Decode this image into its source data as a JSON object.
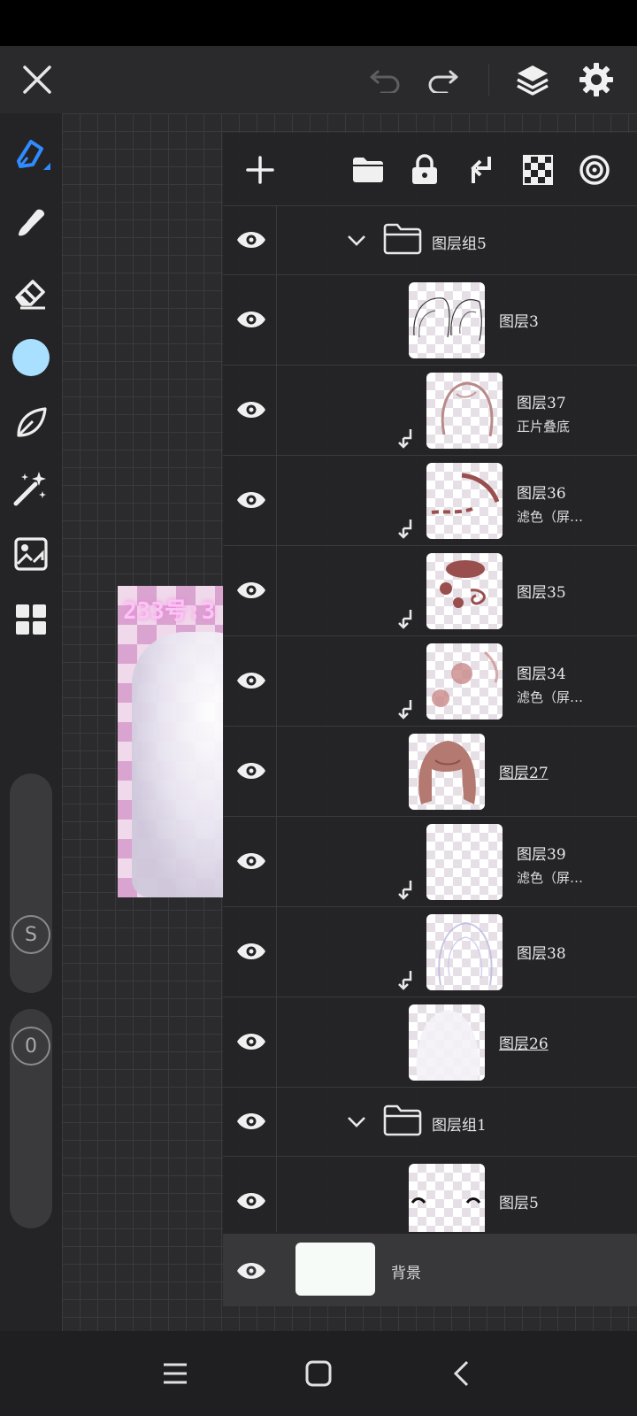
{
  "colors": {
    "accent_blue": "#2f8bff",
    "brush_color": "#a9e0ff",
    "panel_bg": "#242426",
    "text": "#e8e8e8"
  },
  "topbar": {
    "icons": [
      "close-icon",
      "undo-icon",
      "redo-icon",
      "layers-icon",
      "settings-icon"
    ]
  },
  "left_tools": {
    "items": [
      "pen-tool-icon",
      "smudge-icon",
      "eraser-icon",
      "color-swatch",
      "leaf-brush-icon",
      "magic-wand-icon",
      "image-import-icon",
      "grid-menu-icon"
    ],
    "size_slider_label": "S",
    "opacity_slider_label": "0"
  },
  "artwork": {
    "overlay_text": "233号:3"
  },
  "layers_panel": {
    "toolbar_icons": [
      "add-layer-icon",
      "folder-icon",
      "lock-icon",
      "merge-down-icon",
      "transparency-lock-icon",
      "target-icon"
    ],
    "groups": [
      {
        "name": "图层组5"
      },
      {
        "name": "图层组1"
      }
    ],
    "layers": [
      {
        "name": "图层3",
        "mode": ""
      },
      {
        "name": "图层37",
        "mode": "正片叠底"
      },
      {
        "name": "图层36",
        "mode": "滤色（屏…"
      },
      {
        "name": "图层35",
        "mode": ""
      },
      {
        "name": "图层34",
        "mode": "滤色（屏…"
      },
      {
        "name": "图层27",
        "mode": ""
      },
      {
        "name": "图层39",
        "mode": "滤色（屏…"
      },
      {
        "name": "图层38",
        "mode": ""
      },
      {
        "name": "图层26",
        "mode": ""
      },
      {
        "name": "图层5",
        "mode": ""
      }
    ],
    "background": {
      "name": "背景"
    }
  },
  "navbar": {
    "icons": [
      "recent-apps-icon",
      "home-icon",
      "back-icon"
    ]
  }
}
